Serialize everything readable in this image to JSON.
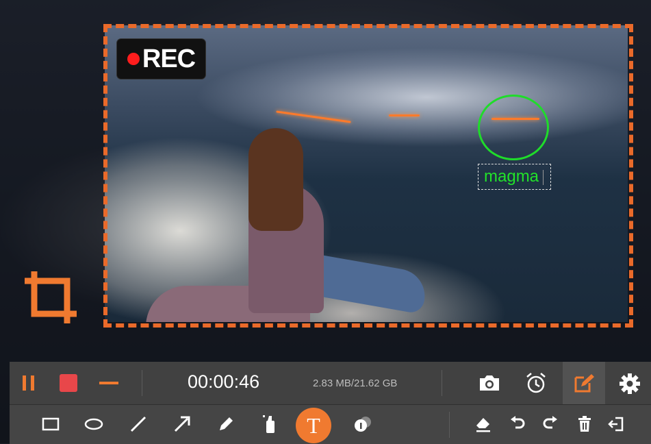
{
  "recording": {
    "badge_label": "REC",
    "timer": "00:00:46",
    "file_size": "2.83 MB/21.62 GB"
  },
  "annotation": {
    "text": "magma"
  },
  "icons": {
    "pause": "pause-icon",
    "stop": "stop-icon",
    "minimize": "minimize-icon",
    "camera": "camera-icon",
    "timer": "alarm-clock-icon",
    "edit": "edit-pencil-icon",
    "settings": "gear-icon",
    "rectangle": "rectangle-icon",
    "ellipse": "ellipse-icon",
    "line": "line-icon",
    "arrow": "arrow-icon",
    "pen": "pen-icon",
    "highlighter": "highlighter-icon",
    "text": "text-tool-icon",
    "callout": "callout-icon",
    "eraser": "eraser-icon",
    "undo": "undo-icon",
    "redo": "redo-icon",
    "delete": "trash-icon",
    "exit": "exit-icon",
    "crop": "crop-icon"
  },
  "tools": {
    "text_tool_glyph": "T"
  },
  "colors": {
    "accent": "#f07a30",
    "stop": "#e8474a",
    "annotation": "#22e22a",
    "crop_border": "#ea6a2a",
    "rec_dot": "#ff1d1d"
  }
}
